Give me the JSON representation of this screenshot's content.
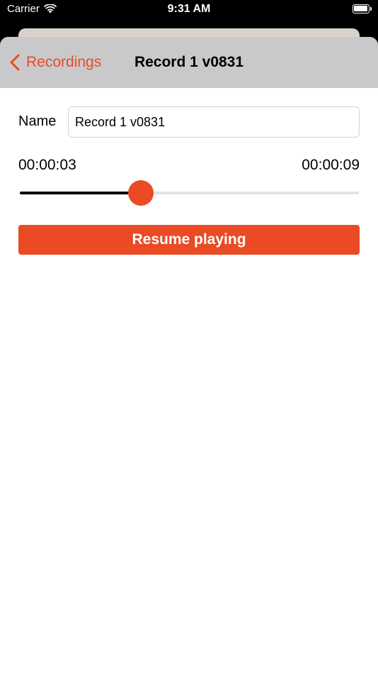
{
  "status_bar": {
    "carrier": "Carrier",
    "time": "9:31 AM",
    "wifi_icon": "wifi-icon",
    "battery_icon": "battery-icon"
  },
  "nav": {
    "back_label": "Recordings",
    "back_icon": "chevron-left-icon",
    "title": "Record 1 v0831"
  },
  "form": {
    "name_label": "Name",
    "name_value": "Record 1 v0831"
  },
  "player": {
    "elapsed": "00:00:03",
    "total": "00:00:09",
    "progress_fraction": 0.357,
    "resume_label": "Resume playing"
  },
  "colors": {
    "accent": "#ea4a24",
    "nav_background": "#c9c9cb",
    "slider_fill": "#000000",
    "slider_track": "#e3e3e5"
  }
}
